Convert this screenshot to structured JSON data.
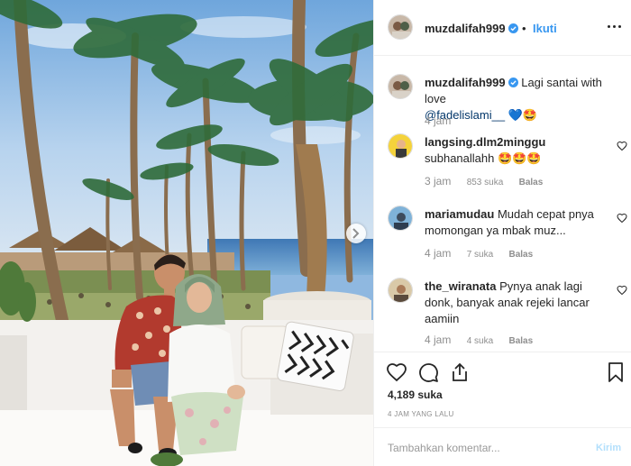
{
  "post": {
    "image_alt": "Couple sitting on white sofa at beach club with palm trees",
    "colors": {
      "accent": "#3897f0",
      "verified": "#3897f0",
      "muted": "#8e8e8e",
      "link": "#003569"
    }
  },
  "header": {
    "username": "muzdalifah999",
    "separator": "•",
    "follow_label": "Ikuti",
    "more_icon": "more-options-icon"
  },
  "caption": {
    "username": "muzdalifah999",
    "text": "Lagi santai with love",
    "mention": "@fadelislami__",
    "emoji": "💙🤩",
    "time": "4 jam"
  },
  "comments": [
    {
      "username": "langsing.dlm2minggu",
      "text": "subhanallahh 🤩🤩🤩",
      "time": "3 jam",
      "likes": "853 suka",
      "reply": "Balas"
    },
    {
      "username": "mariamudau",
      "text": "Mudah cepat pnya momongan ya mbak muz...",
      "time": "4 jam",
      "likes": "7 suka",
      "reply": "Balas"
    },
    {
      "username": "the_wiranata",
      "text": "Pynya anak lagi donk, banyak anak rejeki lancar aamiin",
      "time": "4 jam",
      "likes": "4 suka",
      "reply": "Balas"
    }
  ],
  "actions": {
    "like_icon": "heart-icon",
    "comment_icon": "comment-icon",
    "share_icon": "share-icon",
    "save_icon": "bookmark-icon",
    "likes": "4,189 suka",
    "time_ago": "4 JAM YANG LALU"
  },
  "add_comment": {
    "placeholder": "Tambahkan komentar...",
    "post_label": "Kirim"
  }
}
